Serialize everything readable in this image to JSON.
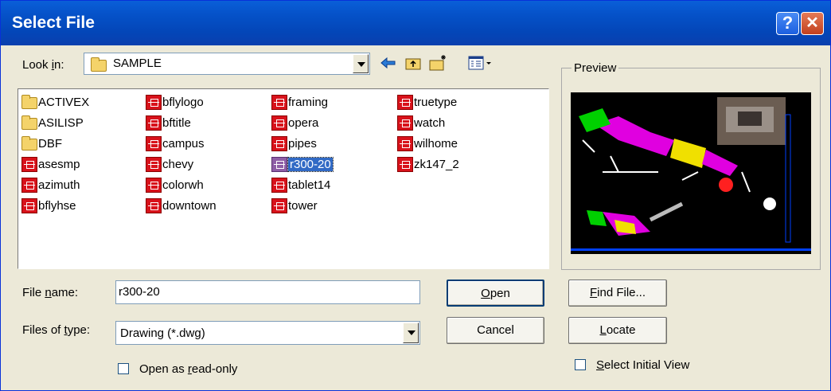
{
  "window": {
    "title": "Select File"
  },
  "look_in": {
    "label_pre": "Look ",
    "label_key": "i",
    "label_post": "n:",
    "value": "SAMPLE"
  },
  "preview": {
    "label": "Preview"
  },
  "files": [
    {
      "name": "ACTIVEX",
      "type": "folder"
    },
    {
      "name": "ASILISP",
      "type": "folder"
    },
    {
      "name": "DBF",
      "type": "folder"
    },
    {
      "name": "asesmp",
      "type": "dwg"
    },
    {
      "name": "azimuth",
      "type": "dwg"
    },
    {
      "name": "bflyhse",
      "type": "dwg"
    },
    {
      "name": "bflylogo",
      "type": "dwg"
    },
    {
      "name": "bftitle",
      "type": "dwg"
    },
    {
      "name": "campus",
      "type": "dwg"
    },
    {
      "name": "chevy",
      "type": "dwg"
    },
    {
      "name": "colorwh",
      "type": "dwg"
    },
    {
      "name": "downtown",
      "type": "dwg"
    },
    {
      "name": "framing",
      "type": "dwg"
    },
    {
      "name": "opera",
      "type": "dwg"
    },
    {
      "name": "pipes",
      "type": "dwg"
    },
    {
      "name": "r300-20",
      "type": "dwg",
      "selected": true
    },
    {
      "name": "tablet14",
      "type": "dwg"
    },
    {
      "name": "tower",
      "type": "dwg"
    },
    {
      "name": "truetype",
      "type": "dwg"
    },
    {
      "name": "watch",
      "type": "dwg"
    },
    {
      "name": "wilhome",
      "type": "dwg"
    },
    {
      "name": "zk147_2",
      "type": "dwg"
    }
  ],
  "file_name": {
    "label_pre": "File ",
    "label_key": "n",
    "label_post": "ame:",
    "value": "r300-20"
  },
  "file_type": {
    "label_pre": "Files of ",
    "label_key": "t",
    "label_post": "ype:",
    "value": "Drawing (*.dwg)"
  },
  "read_only": {
    "label_pre": "Open as ",
    "label_key": "r",
    "label_post": "ead-only"
  },
  "buttons": {
    "open": {
      "key": "O",
      "rest": "pen"
    },
    "cancel": "Cancel",
    "find": {
      "key": "F",
      "rest": "ind File..."
    },
    "locate": {
      "key": "L",
      "rest": "ocate"
    }
  },
  "initial_view": {
    "key": "S",
    "rest": "elect Initial View"
  },
  "colors": {
    "titlebar": "#0552c9",
    "selection": "#316ac5",
    "dwg_icon": "#d8121b"
  },
  "icons": [
    "back-arrow-icon",
    "up-folder-icon",
    "new-folder-icon",
    "view-menu-icon",
    "help-icon",
    "close-icon"
  ]
}
